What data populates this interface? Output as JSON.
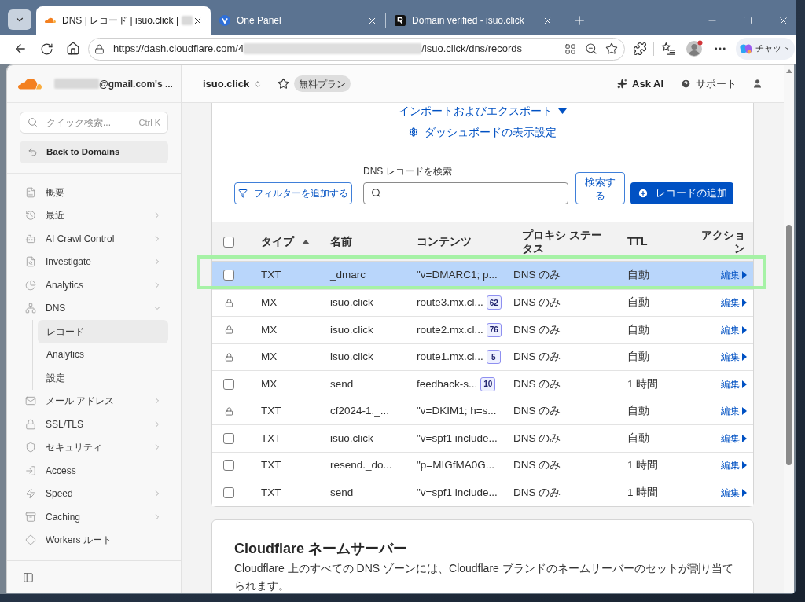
{
  "browser": {
    "tabs": [
      {
        "title": "DNS | レコード | isuo.click |",
        "selected": true,
        "redacted": true
      },
      {
        "title": "One Panel",
        "selected": false,
        "redacted": false
      },
      {
        "title": "Domain verified - isuo.click",
        "selected": false,
        "redacted": false
      }
    ],
    "address_bar": {
      "url_prefix": "https://dash.cloudflare.com/4",
      "url_suffix": "/isuo.click/dns/records"
    },
    "copilot_button": "チャット"
  },
  "sidebar": {
    "account": "@gmail.com's ...",
    "search": {
      "placeholder": "クイック検索...",
      "shortcut": "Ctrl K"
    },
    "back_button": "Back to Domains",
    "nav": [
      {
        "label": "概要",
        "kind": "link",
        "selected": false
      },
      {
        "label": "最近",
        "kind": "group",
        "expanded": false,
        "selected": false
      },
      {
        "label": "AI Crawl Control",
        "kind": "group",
        "expanded": false,
        "selected": false
      },
      {
        "label": "Investigate",
        "kind": "group",
        "expanded": false,
        "selected": false
      },
      {
        "label": "Analytics",
        "kind": "group",
        "expanded": false,
        "selected": false
      },
      {
        "label": "DNS",
        "kind": "group",
        "expanded": true,
        "selected": false,
        "children": [
          {
            "label": "レコード",
            "selected": true
          },
          {
            "label": "Analytics",
            "selected": false
          },
          {
            "label": "設定",
            "selected": false
          }
        ]
      },
      {
        "label": "メール アドレス",
        "kind": "group",
        "expanded": false,
        "selected": false
      },
      {
        "label": "SSL/TLS",
        "kind": "group",
        "expanded": false,
        "selected": false
      },
      {
        "label": "セキュリティ",
        "kind": "group",
        "expanded": false,
        "selected": false
      },
      {
        "label": "Access",
        "kind": "link",
        "selected": false
      },
      {
        "label": "Speed",
        "kind": "group",
        "expanded": false,
        "selected": false
      },
      {
        "label": "Caching",
        "kind": "group",
        "expanded": false,
        "selected": false
      },
      {
        "label": "Workers ルート",
        "kind": "link",
        "selected": false
      }
    ]
  },
  "header": {
    "zone": "isuo.click",
    "starred": false,
    "plan_badge": "無料プラン",
    "ask_ai": "Ask AI",
    "support": "サポート"
  },
  "dns_card": {
    "import_export": "インポートおよびエクスポート",
    "dashboard_settings": "ダッシュボードの表示設定",
    "filter_button": "フィルターを追加する",
    "search": {
      "label": "DNS レコードを検索"
    },
    "search_button": "検索する",
    "add_button": "レコードの追加",
    "table": {
      "select_all_checked": false,
      "columns": [
        {
          "label": "タイプ",
          "sorted": true
        },
        {
          "label": "名前",
          "sorted": false
        },
        {
          "label": "コンテンツ",
          "sorted": false
        },
        {
          "label": "プロキシ ステータス",
          "sorted": false
        },
        {
          "label": "TTL",
          "sorted": false
        },
        {
          "label": "アクション",
          "sorted": false
        }
      ],
      "rows": [
        {
          "kind": "checkbox",
          "checked": false,
          "selected": true,
          "outlined": true,
          "type": "TXT",
          "name": "_dmarc",
          "content": "\"v=DMARC1; p...",
          "proxy": "DNS のみ",
          "ttl": "自動",
          "action": "編集"
        },
        {
          "kind": "locked",
          "selected": false,
          "outlined": false,
          "type": "MX",
          "name": "isuo.click",
          "content": "route3.mx.cl...",
          "badge": "62",
          "proxy": "DNS のみ",
          "ttl": "自動",
          "action": "編集"
        },
        {
          "kind": "locked",
          "selected": false,
          "outlined": false,
          "type": "MX",
          "name": "isuo.click",
          "content": "route2.mx.cl...",
          "badge": "76",
          "proxy": "DNS のみ",
          "ttl": "自動",
          "action": "編集"
        },
        {
          "kind": "locked",
          "selected": false,
          "outlined": false,
          "type": "MX",
          "name": "isuo.click",
          "content": "route1.mx.cl...",
          "badge": "5",
          "proxy": "DNS のみ",
          "ttl": "自動",
          "action": "編集"
        },
        {
          "kind": "checkbox",
          "checked": false,
          "selected": false,
          "outlined": false,
          "type": "MX",
          "name": "send",
          "content": "feedback-s...",
          "badge": "10",
          "proxy": "DNS のみ",
          "ttl": "1 時間",
          "action": "編集"
        },
        {
          "kind": "locked",
          "selected": false,
          "outlined": false,
          "type": "TXT",
          "name": "cf2024-1._...",
          "content": "\"v=DKIM1; h=s...",
          "proxy": "DNS のみ",
          "ttl": "自動",
          "action": "編集"
        },
        {
          "kind": "checkbox",
          "checked": false,
          "selected": false,
          "outlined": false,
          "type": "TXT",
          "name": "isuo.click",
          "content": "\"v=spf1 include...",
          "proxy": "DNS のみ",
          "ttl": "自動",
          "action": "編集"
        },
        {
          "kind": "checkbox",
          "checked": false,
          "selected": false,
          "outlined": false,
          "type": "TXT",
          "name": "resend._do...",
          "content": "\"p=MIGfMA0G...",
          "proxy": "DNS のみ",
          "ttl": "1 時間",
          "action": "編集"
        },
        {
          "kind": "checkbox",
          "checked": false,
          "selected": false,
          "outlined": false,
          "type": "TXT",
          "name": "send",
          "content": "\"v=spf1 include...",
          "proxy": "DNS のみ",
          "ttl": "1 時間",
          "action": "編集"
        }
      ]
    }
  },
  "nameserver_card": {
    "title": "Cloudflare ネームサーバー",
    "description": "Cloudflare 上のすべての DNS ゾーンには、Cloudflare ブランドのネームサーバーのセットが割り当てられます。"
  }
}
